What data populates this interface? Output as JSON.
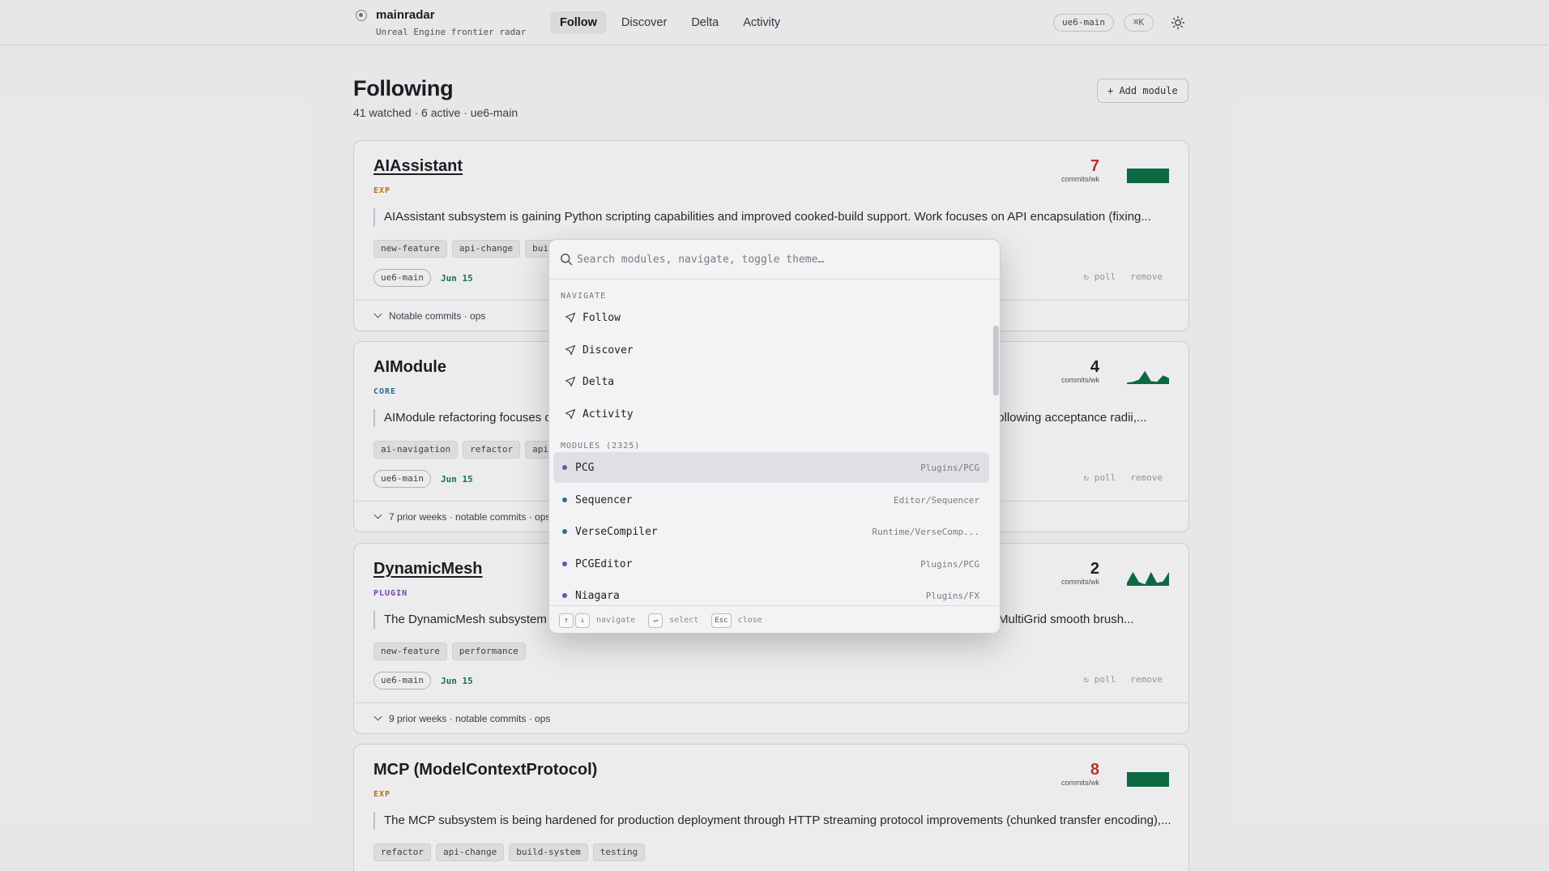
{
  "app": {
    "name": "mainradar",
    "subtitle": "Unreal Engine frontier radar",
    "nav": [
      {
        "label": "Follow",
        "active": true
      },
      {
        "label": "Discover",
        "active": false
      },
      {
        "label": "Delta",
        "active": false
      },
      {
        "label": "Activity",
        "active": false
      }
    ],
    "branch": "ue6-main",
    "shortcut": "⌘K",
    "theme_icon": "sun-icon"
  },
  "page": {
    "title": "Following",
    "subtitle": "41 watched · 6 active · ue6-main",
    "add_button": "+ Add module"
  },
  "colors": {
    "accent_green": "#0d6e46",
    "date_green": "#1a7a4a",
    "exp": "#b8780f",
    "core": "#2f6f8f",
    "plugin": "#7b48b8",
    "stat_red": "#c4322b"
  },
  "cards": [
    {
      "name": "AIAssistant",
      "kind": "EXP",
      "summary": "AIAssistant subsystem is gaining Python scripting capabilities and improved cooked-build support. Work focuses on API encapsulation (fixing...",
      "tags": [
        "new-feature",
        "api-change",
        "bui"
      ],
      "branch": "ue6-main",
      "date": "Jun 15",
      "poll": "poll",
      "remove": "remove",
      "stat": "7",
      "stat_label": "commits/wk",
      "spark": [
        1,
        1,
        1,
        1,
        1,
        1,
        1,
        1
      ],
      "footer": "Notable commits · ops"
    },
    {
      "name": "AIModule",
      "kind": "CORE",
      "summary": "AIModule refactoring focuses o",
      "summary_end": "following acceptance radii,...",
      "tags": [
        "ai-navigation",
        "refactor",
        "api"
      ],
      "branch": "ue6-main",
      "date": "Jun 15",
      "poll": "poll",
      "remove": "remove",
      "stat": "4",
      "stat_label": "commits/wk",
      "spark": [
        0.1,
        0.15,
        0.3,
        0.9,
        0.2,
        0.15,
        0.6,
        0.4
      ],
      "footer": "7 prior weeks · notable commits · ops"
    },
    {
      "name": "DynamicMesh",
      "kind": "PLUGIN",
      "summary": "The DynamicMesh subsystem i",
      "summary_end": "(MultiGrid smooth brush...",
      "tags": [
        "new-feature",
        "performance"
      ],
      "branch": "ue6-main",
      "date": "Jun 15",
      "poll": "poll",
      "remove": "remove",
      "stat": "2",
      "stat_label": "commits/wk",
      "spark": [
        0.2,
        0.95,
        0.25,
        0.1,
        0.95,
        0.2,
        0.3,
        0.95
      ],
      "footer": "9 prior weeks · notable commits · ops"
    },
    {
      "name": "MCP (ModelContextProtocol)",
      "kind": "EXP",
      "summary": "The MCP subsystem is being hardened for production deployment through HTTP streaming protocol improvements (chunked transfer encoding),...",
      "tags": [
        "refactor",
        "api-change",
        "build-system",
        "testing"
      ],
      "stat": "8",
      "stat_label": "commits/wk",
      "spark": [
        1,
        1,
        1,
        1,
        1,
        1,
        1,
        1
      ]
    }
  ],
  "palette": {
    "placeholder": "Search modules, navigate, toggle theme…",
    "navigate_label": "NAVIGATE",
    "navigate_items": [
      "Follow",
      "Discover",
      "Delta",
      "Activity"
    ],
    "modules_label": "MODULES (2325)",
    "modules": [
      {
        "name": "PCG",
        "path": "Plugins/PCG",
        "color": "#7b48b8"
      },
      {
        "name": "Sequencer",
        "path": "Editor/Sequencer",
        "color": "#2f6f8f"
      },
      {
        "name": "VerseCompiler",
        "path": "Runtime/VerseComp...",
        "color": "#2f6f8f"
      },
      {
        "name": "PCGEditor",
        "path": "Plugins/PCG",
        "color": "#7b48b8"
      },
      {
        "name": "Niagara",
        "path": "Plugins/FX",
        "color": "#7b48b8"
      }
    ],
    "hints": {
      "up": "↑",
      "down": "↓",
      "navigate": "navigate",
      "enter": "↵",
      "select": "select",
      "esc": "Esc",
      "close": "close"
    }
  }
}
